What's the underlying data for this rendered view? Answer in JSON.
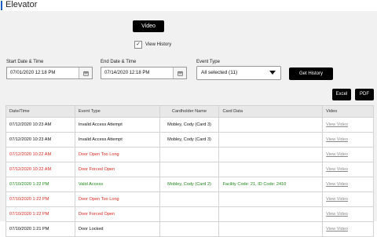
{
  "title": "Elevator",
  "video_button": "Video",
  "view_history": {
    "label": "View History",
    "checked": true
  },
  "filters": {
    "start_label": "Start Date & Time",
    "start_value": "07/01/2020 12:18 PM",
    "end_label": "End Date & Time",
    "end_value": "07/14/2020 12:18 PM",
    "event_type_label": "Event Type",
    "event_type_value": "All selected (11)"
  },
  "get_history_button": "Get History",
  "export": {
    "excel": "Excel",
    "pdf": "PDF"
  },
  "table": {
    "headers": [
      "Date/Time",
      "Event Type",
      "Cardholder Name",
      "Card Data",
      "Video"
    ],
    "rows": [
      {
        "date": "07/12/2020 10:23 AM",
        "event": "Invalid Access Attempt",
        "cardholder": "Mobley, Cody (Card 3)",
        "card_data": "",
        "video": "View Video",
        "color": "black"
      },
      {
        "date": "07/12/2020 10:23 AM",
        "event": "Invalid Access Attempt",
        "cardholder": "Mobley, Cody (Card 3)",
        "card_data": "",
        "video": "View Video",
        "color": "black"
      },
      {
        "date": "07/12/2020 10:22 AM",
        "event": "Door Open Too Long",
        "cardholder": "",
        "card_data": "",
        "video": "View Video",
        "color": "red"
      },
      {
        "date": "07/12/2020 10:22 AM",
        "event": "Door Forced Open",
        "cardholder": "",
        "card_data": "",
        "video": "View Video",
        "color": "red"
      },
      {
        "date": "07/10/2020 1:22 PM",
        "event": "Valid Access",
        "cardholder": "Mobley, Cody (Card 2)",
        "card_data": "Facility Code: 21, ID Code: 2410",
        "video": "View Video",
        "color": "green"
      },
      {
        "date": "07/10/2020 1:22 PM",
        "event": "Door Open Too Long",
        "cardholder": "",
        "card_data": "",
        "video": "View Video",
        "color": "red"
      },
      {
        "date": "07/10/2020 1:22 PM",
        "event": "Door Forced Open",
        "cardholder": "",
        "card_data": "",
        "video": "View Video",
        "color": "red"
      },
      {
        "date": "07/10/2020 1:21 PM",
        "event": "Door Locked",
        "cardholder": "",
        "card_data": "",
        "video": "View Video",
        "color": "black"
      }
    ]
  }
}
